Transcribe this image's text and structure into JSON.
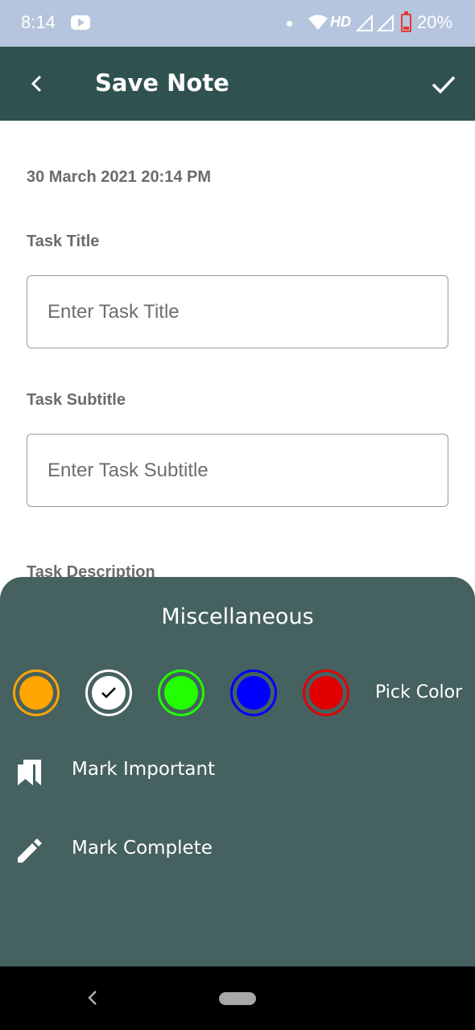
{
  "status_bar": {
    "time": "8:14",
    "network": "HD",
    "battery": "20%"
  },
  "toolbar": {
    "title": "Save Note"
  },
  "form": {
    "date": "30 March 2021 20:14 PM",
    "title_label": "Task Title",
    "title_placeholder": "Enter Task Title",
    "subtitle_label": "Task Subtitle",
    "subtitle_placeholder": "Enter Task Subtitle",
    "description_label": "Task Description"
  },
  "sheet": {
    "title": "Miscellaneous",
    "colors": [
      {
        "name": "orange",
        "hex": "#FFA500",
        "selected": false
      },
      {
        "name": "white",
        "hex": "#FFFFFF",
        "selected": true
      },
      {
        "name": "green",
        "hex": "#22FF00",
        "selected": false
      },
      {
        "name": "blue",
        "hex": "#0000FF",
        "selected": false
      },
      {
        "name": "red",
        "hex": "#E00000",
        "selected": false
      }
    ],
    "pick_color_label": "Pick Color",
    "mark_important_label": "Mark Important",
    "mark_complete_label": "Mark Complete"
  },
  "theme": {
    "toolbar_color": "#2F5150",
    "sheet_color": "#456160",
    "status_bar_color": "#B5C5DD"
  }
}
